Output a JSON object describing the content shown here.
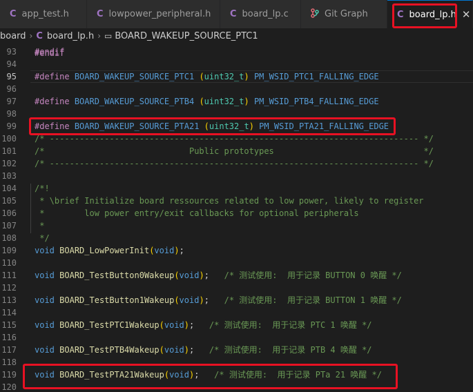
{
  "tabs": [
    {
      "label": "app_test.h",
      "icon": "c-file-icon",
      "active": false
    },
    {
      "label": "lowpower_peripheral.h",
      "icon": "c-file-icon",
      "active": false
    },
    {
      "label": "board_lp.c",
      "icon": "c-file-icon",
      "active": false
    },
    {
      "label": "Git Graph",
      "icon": "git-graph-icon",
      "active": false
    },
    {
      "label": "board_lp.h",
      "icon": "c-file-icon",
      "active": true
    }
  ],
  "icons": {
    "c_file": "C",
    "close": "✕",
    "symbol": "▭",
    "chevron": "›"
  },
  "breadcrumb": {
    "folder": "board",
    "file": "board_lp.h",
    "symbol": "BOARD_WAKEUP_SOURCE_PTC1"
  },
  "editor": {
    "partial_top_line": "#endif",
    "lines": [
      {
        "num": "93",
        "text": "#endif"
      },
      {
        "num": "94",
        "text": ""
      },
      {
        "num": "95",
        "text": "#define BOARD_WAKEUP_SOURCE_PTC1 (uint32_t) PM_WSID_PTC1_FALLING_EDGE"
      },
      {
        "num": "96",
        "text": ""
      },
      {
        "num": "97",
        "text": "#define BOARD_WAKEUP_SOURCE_PTB4 (uint32_t) PM_WSID_PTB4_FALLING_EDGE"
      },
      {
        "num": "98",
        "text": ""
      },
      {
        "num": "99",
        "text": "#define BOARD_WAKEUP_SOURCE_PTA21 (uint32_t) PM_WSID_PTA21_FALLING_EDGE"
      },
      {
        "num": "100",
        "text": "/* -------------------------------------------------------------------------- */"
      },
      {
        "num": "101",
        "text": "/*                             Public prototypes                              */"
      },
      {
        "num": "102",
        "text": "/* -------------------------------------------------------------------------- */"
      },
      {
        "num": "103",
        "text": ""
      },
      {
        "num": "104",
        "text": "/*!"
      },
      {
        "num": "105",
        "text": " * \\brief Initialize board ressources related to low power, likely to register"
      },
      {
        "num": "106",
        "text": " *        low power entry/exit callbacks for optional peripherals"
      },
      {
        "num": "107",
        "text": " *"
      },
      {
        "num": "108",
        "text": " */"
      },
      {
        "num": "109",
        "text": "void BOARD_LowPowerInit(void);"
      },
      {
        "num": "110",
        "text": ""
      },
      {
        "num": "111",
        "text": "void BOARD_TestButton0Wakeup(void);   /* 测试使用:  用于记录 BUTTON 0 唤醒 */"
      },
      {
        "num": "112",
        "text": ""
      },
      {
        "num": "113",
        "text": "void BOARD_TestButton1Wakeup(void);   /* 测试使用:  用于记录 BUTTON 1 唤醒 */"
      },
      {
        "num": "114",
        "text": ""
      },
      {
        "num": "115",
        "text": "void BOARD_TestPTC1Wakeup(void);   /* 测试使用:  用于记录 PTC 1 唤醒 */"
      },
      {
        "num": "116",
        "text": ""
      },
      {
        "num": "117",
        "text": "void BOARD_TestPTB4Wakeup(void);   /* 测试使用:  用于记录 PTB 4 唤醒 */"
      },
      {
        "num": "118",
        "text": ""
      },
      {
        "num": "119",
        "text": "void BOARD_TestPTA21Wakeup(void);   /* 测试使用:  用于记录 PTa 21 唤醒 */"
      },
      {
        "num": "120",
        "text": ""
      }
    ]
  },
  "colors": {
    "editor_bg": "#1e1e1e",
    "highlight_box": "#e81123",
    "preprocessor": "#c586c0",
    "macro": "#569cd6",
    "type": "#4ec9b0",
    "function": "#dcdcaa",
    "comment": "#6a9955"
  }
}
